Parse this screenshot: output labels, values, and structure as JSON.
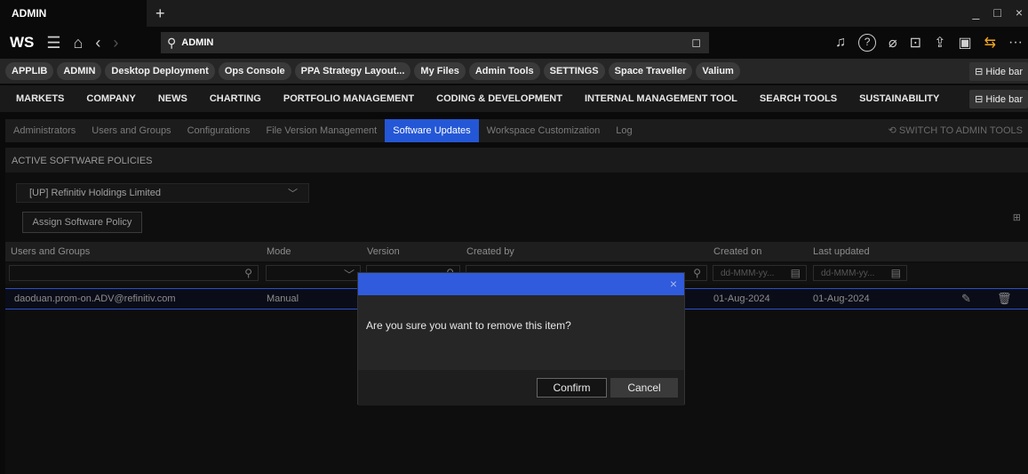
{
  "window": {
    "tab_title": "ADMIN",
    "add_tab": "+",
    "controls": [
      "_",
      "□",
      "×"
    ]
  },
  "toolbar": {
    "logo": "WS",
    "search_value": "ADMIN"
  },
  "app_pills": [
    "APPLIB",
    "ADMIN",
    "Desktop Deployment",
    "Ops Console",
    "PPA Strategy Layout...",
    "My Files",
    "Admin Tools",
    "SETTINGS",
    "Space Traveller",
    "Valium"
  ],
  "hide_bar_label": "Hide bar",
  "menu": [
    "MARKETS",
    "COMPANY",
    "NEWS",
    "CHARTING",
    "PORTFOLIO MANAGEMENT",
    "CODING & DEVELOPMENT",
    "INTERNAL MANAGEMENT TOOL",
    "SEARCH TOOLS",
    "SUSTAINABILITY"
  ],
  "subtabs": [
    "Administrators",
    "Users and Groups",
    "Configurations",
    "File Version Management",
    "Software Updates",
    "Workspace Customization",
    "Log"
  ],
  "active_subtab": "Software Updates",
  "switch_admin_label": "SWITCH TO ADMIN TOOLS",
  "section_title": "ACTIVE SOFTWARE POLICIES",
  "org_select_value": "[UP] Refinitiv Holdings Limited",
  "assign_button": "Assign Software Policy",
  "grid": {
    "columns": [
      "Users and Groups",
      "Mode",
      "Version",
      "Created by",
      "Created on",
      "Last updated"
    ],
    "date_placeholder": "dd-MMM-yy...",
    "rows": [
      {
        "user": "daoduan.prom-on.ADV@refinitiv.com",
        "mode": "Manual",
        "created_on": "01-Aug-2024",
        "last_updated": "01-Aug-2024"
      }
    ]
  },
  "modal": {
    "message": "Are you sure you want to remove this item?",
    "confirm": "Confirm",
    "cancel": "Cancel",
    "close": "×"
  },
  "colors": {
    "accent": "#2f5bdc",
    "background": "#0a0a0a",
    "orange": "#f5a623"
  }
}
